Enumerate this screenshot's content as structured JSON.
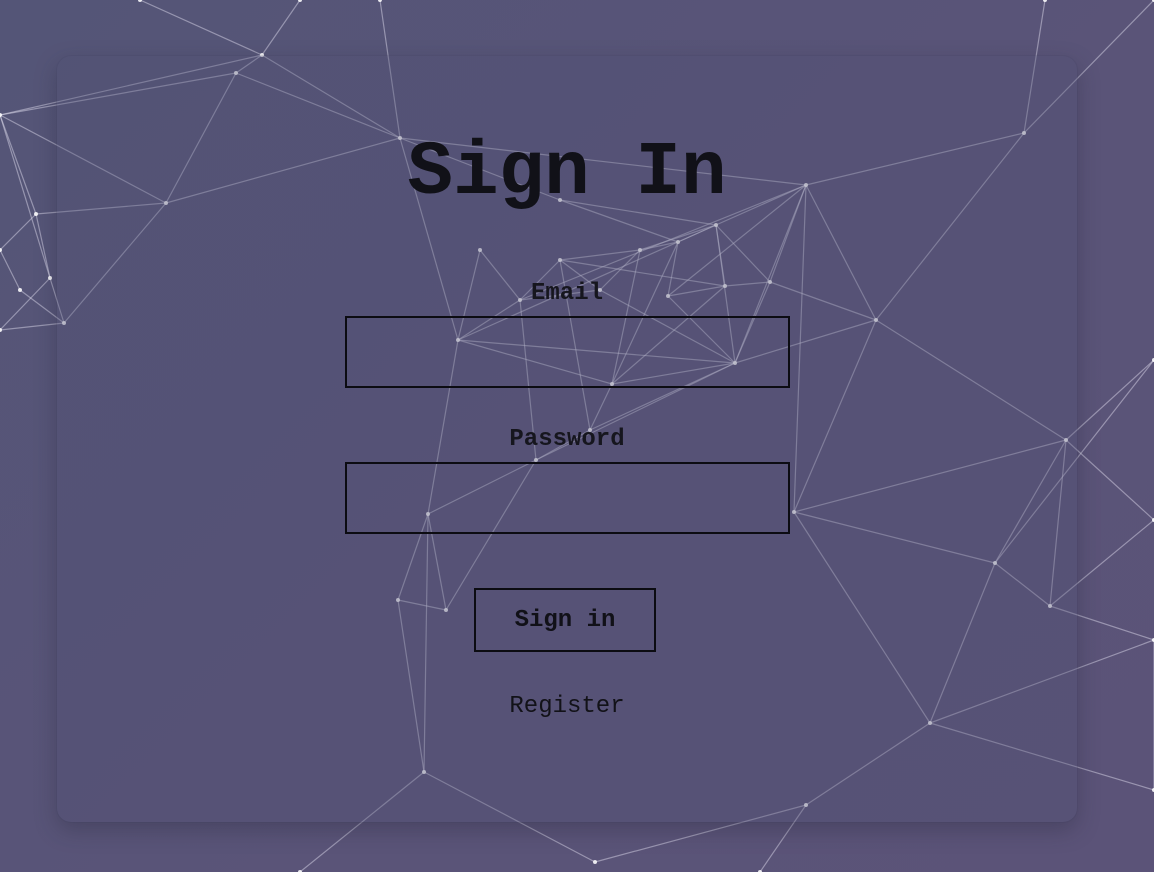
{
  "page": {
    "title": "Sign In"
  },
  "form": {
    "email_label": "Email",
    "email_value": "",
    "password_label": "Password",
    "password_value": "",
    "submit_label": "Sign in",
    "register_link": "Register"
  },
  "colors": {
    "background": "#575677",
    "text": "#111118",
    "network_line": "#e6e4f5"
  }
}
